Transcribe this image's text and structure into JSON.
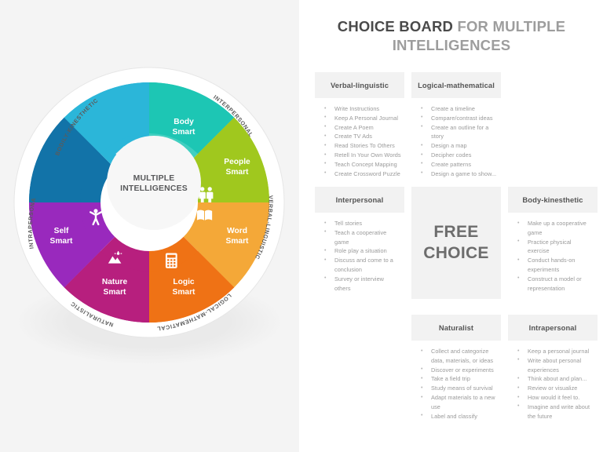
{
  "title": {
    "part_dark": "CHOICE BOARD",
    "part_light": "FOR MULTIPLE INTELLIGENCES"
  },
  "wheel": {
    "hub_line1": "MULTIPLE",
    "hub_line2": "INTELLIGENCES",
    "segments": [
      {
        "id": "body",
        "line1": "Body",
        "line2": "Smart",
        "color": "#1dc6b4",
        "icon": "running-person-icon"
      },
      {
        "id": "people",
        "line1": "People",
        "line2": "Smart",
        "color": "#a0c81e",
        "icon": "two-people-icon"
      },
      {
        "id": "word",
        "line1": "Word",
        "line2": "Smart",
        "color": "#f4a838",
        "icon": "open-book-icon"
      },
      {
        "id": "logic",
        "line1": "Logic",
        "line2": "Smart",
        "color": "#ef7215",
        "icon": "calculator-icon"
      },
      {
        "id": "nature",
        "line1": "Nature",
        "line2": "Smart",
        "color": "#b71f7e",
        "icon": "mountain-icon"
      },
      {
        "id": "self",
        "line1": "Self",
        "line2": "Smart",
        "color": "#9929bd",
        "icon": "person-arms-raised-icon"
      },
      {
        "id": "unlabeled-blue",
        "line1": "",
        "line2": "",
        "color": "#1273a8",
        "icon": ""
      },
      {
        "id": "unlabeled-cyan",
        "line1": "",
        "line2": "",
        "color": "#2bb6d9",
        "icon": ""
      }
    ],
    "ring_labels": [
      "BODILY-KINESTHETIC",
      "INTERPERSONAL",
      "VERBAL-LINGUISTIC",
      "LOGICAL-MATHEMATICAL",
      "NATURALISTIC",
      "INTRAPERSONAL"
    ]
  },
  "free_choice": {
    "line1": "FREE",
    "line2": "CHOICE"
  },
  "cards": [
    {
      "id": "verbal-linguistic",
      "heading": "Verbal-linguistic",
      "items": [
        "Write  Instructions",
        "Keep A Personal Journal",
        "Create A Poem",
        "Create TV Ads",
        "Read Stories To Others",
        "Retell In Your Own Words",
        "Teach Concept  Mapping",
        "Create Crossword  Puzzle"
      ]
    },
    {
      "id": "logical-mathematical",
      "heading": "Logical-mathematical",
      "items": [
        "Create a timeline",
        "Compare/contrast  ideas",
        "Create an outline  for a story",
        "Design  a map",
        "Decipher  codes",
        "Create patterns",
        "Design  a game to show..."
      ]
    },
    {
      "id": "interpersonal",
      "heading": "Interpersonal",
      "items": [
        "Tell stories",
        "Teach a cooperative game",
        "Role  play a situation",
        "Discuss  and come to a conclusion",
        "Survey or interview others"
      ]
    },
    {
      "id": "body-kinesthetic",
      "heading": "Body-kinesthetic",
      "items": [
        "Make up a cooperative game",
        "Practice physical  exercise",
        "Conduct  hands-on experiments",
        "Construct a model  or representation"
      ]
    },
    {
      "id": "naturalist",
      "heading": "Naturalist",
      "items": [
        "Collect  and categorize data, materials,  or ideas",
        "Discover  or experiments",
        "Take a field trip",
        "Study  means of survival",
        "Adapt materials to a new use",
        "Label and classify"
      ]
    },
    {
      "id": "intrapersonal",
      "heading": "Intrapersonal",
      "items": [
        "Keep a personal  journal",
        "Write  about personal experiences",
        "Think about and plan...",
        "Review or visualize",
        "How would  it feel to.",
        "Imagine  and write about the future"
      ]
    }
  ]
}
